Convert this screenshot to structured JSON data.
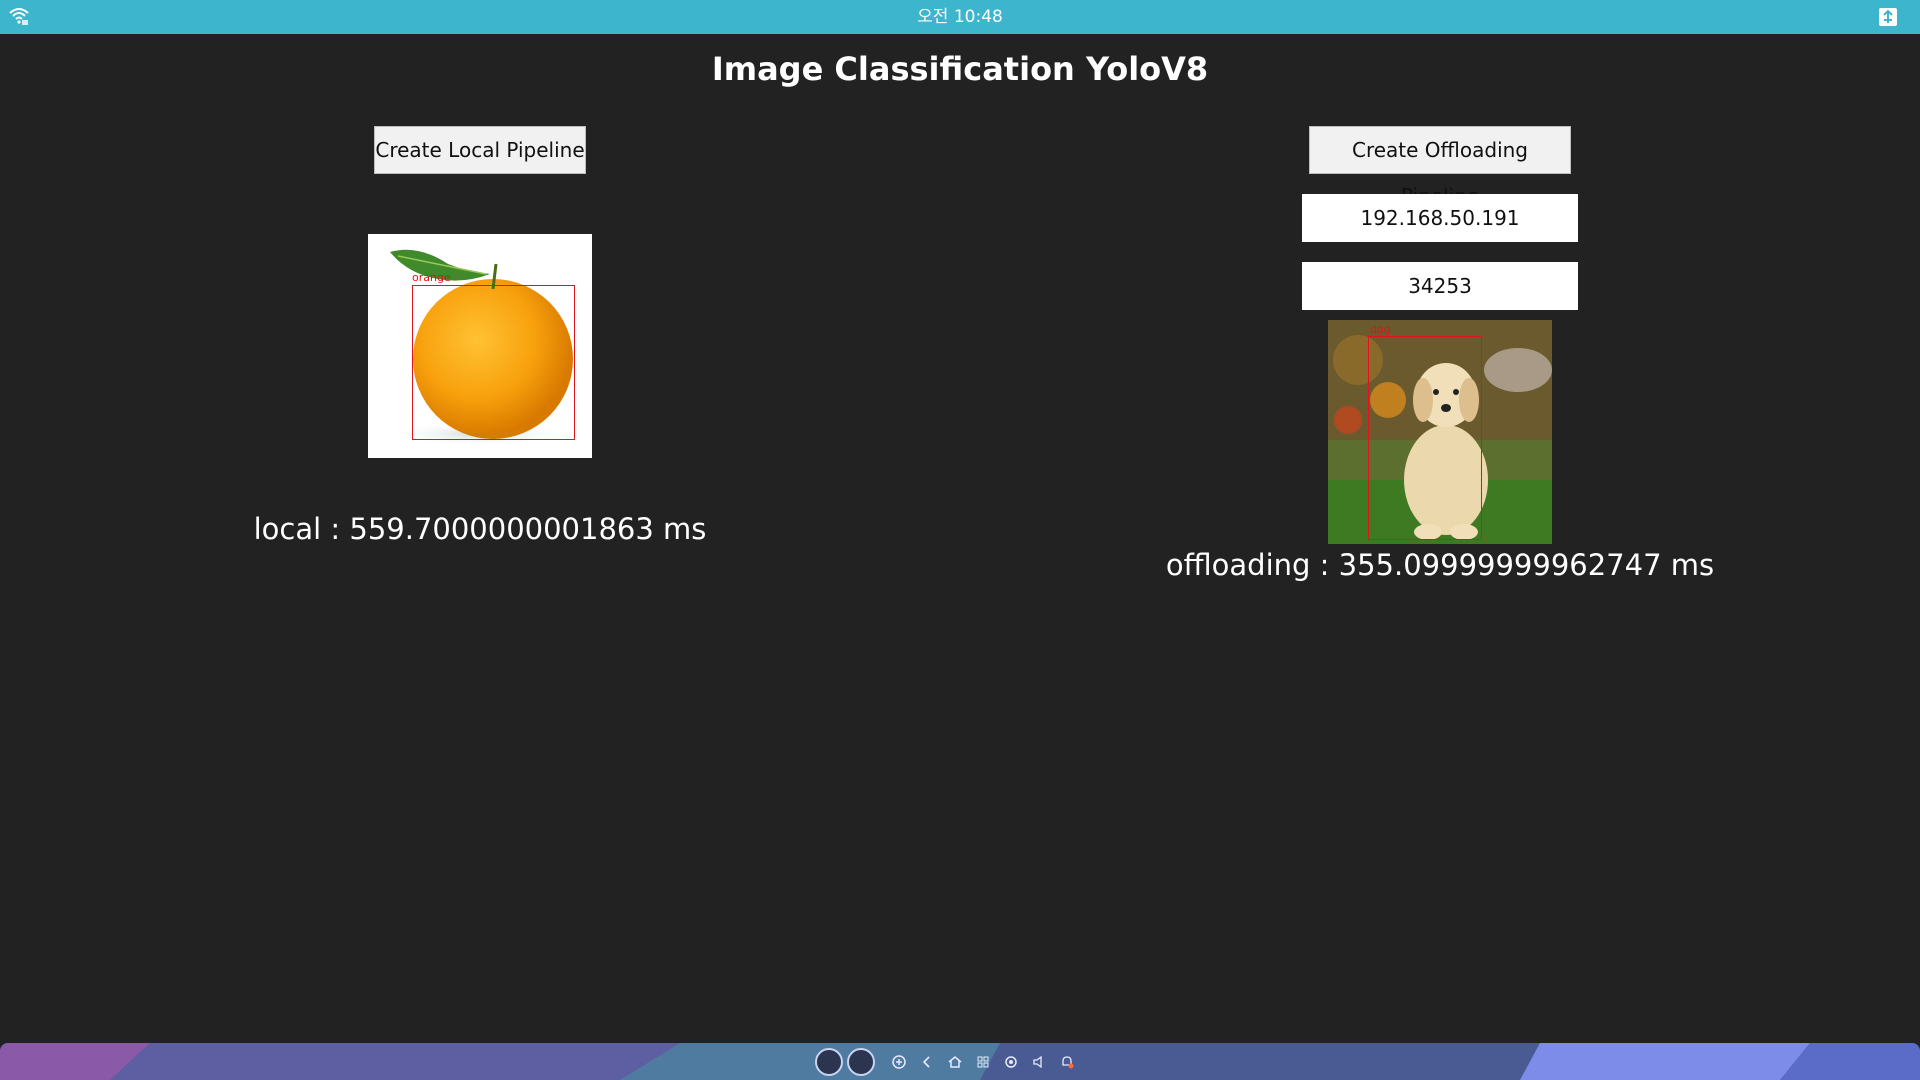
{
  "status_bar": {
    "time": "오전 10:48",
    "background": "#3db5cd"
  },
  "app": {
    "title": "Image Classification YoloV8"
  },
  "local": {
    "button_label": "Create Local Pipeline",
    "detection_label": "orange",
    "result_text": "local : 559.7000000001863 ms"
  },
  "offloading": {
    "button_label": "Create Offloading Pipeline",
    "ip_value": "192.168.50.191",
    "port_value": "34253",
    "detection_label": "dog",
    "result_text": "offloading : 355.09999999962747 ms"
  },
  "taskbar": {
    "icons": [
      "app-icon",
      "app-icon",
      "add-icon",
      "back-icon",
      "home-icon",
      "apps-grid-icon",
      "settings-icon",
      "volume-icon",
      "notification-icon"
    ]
  },
  "colors": {
    "background": "#222222",
    "bbox": "#e0141b",
    "taskbar": "#4a5a93"
  }
}
